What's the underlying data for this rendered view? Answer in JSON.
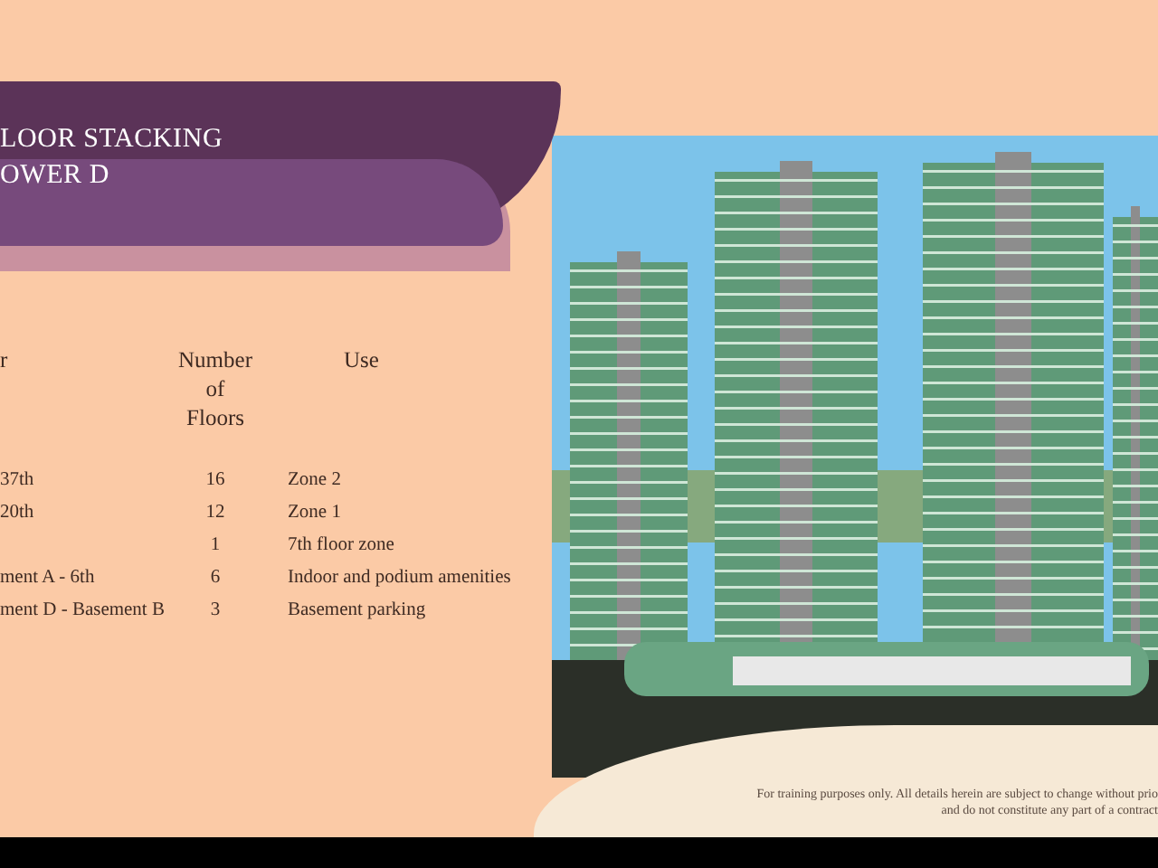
{
  "title": {
    "lines": [
      "LOOR STACKING",
      "OWER D"
    ]
  },
  "table": {
    "columns": [
      "r",
      "Number of Floors",
      "Use"
    ],
    "rows": [
      {
        "floor": "37th",
        "count": "16",
        "use": "Zone 2"
      },
      {
        "floor": "20th",
        "count": "12",
        "use": "Zone 1"
      },
      {
        "count": "1",
        "use": "7th floor zone"
      },
      {
        "floor": "ment A - 6th",
        "count": "6",
        "use": "Indoor and podium amenities"
      },
      {
        "floor": "ment D - Basement B",
        "count": "3",
        "use": "Basement parking"
      }
    ]
  },
  "disclaimer": [
    "For training purposes only. All details herein are subject to change without prio",
    "and do not constitute any part of a contract"
  ]
}
